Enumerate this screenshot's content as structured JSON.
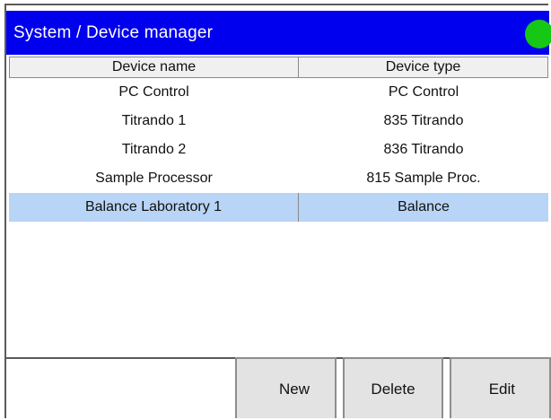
{
  "header": {
    "title": "System / Device manager",
    "status_color": "#16c716"
  },
  "table": {
    "columns": [
      "Device name",
      "Device type"
    ],
    "rows": [
      {
        "name": "PC Control",
        "type": "PC Control"
      },
      {
        "name": "Titrando 1",
        "type": "835 Titrando"
      },
      {
        "name": "Titrando 2",
        "type": "836 Titrando"
      },
      {
        "name": "Sample Processor",
        "type": "815 Sample Proc."
      },
      {
        "name": "Balance Laboratory 1",
        "type": "Balance",
        "selected": true
      }
    ]
  },
  "buttons": {
    "new_label": "New",
    "delete_label": "Delete",
    "edit_label": "Edit"
  },
  "colors": {
    "titlebar": "#0000ee",
    "selection": "#b8d4f6"
  }
}
